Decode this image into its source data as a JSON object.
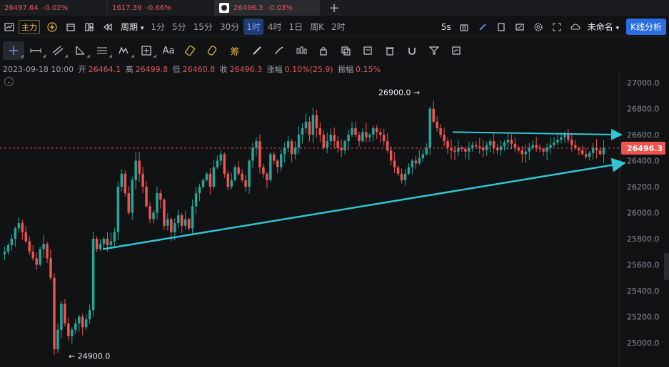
{
  "tabs": [
    {
      "price": "26497.64",
      "change": "-0.02%"
    },
    {
      "price": "1617.39",
      "change": "-0.66%"
    },
    {
      "price": "26496.3",
      "change": "-0.03%"
    }
  ],
  "toolbar": {
    "main_label": "主力",
    "period_label": "周期",
    "intervals": [
      "1分",
      "5分",
      "15分",
      "30分",
      "1时",
      "4时",
      "1日",
      "周K",
      "2时"
    ],
    "active_interval": "1时",
    "refresh": "5s",
    "layout_name": "未命名",
    "kline_analysis": "K线分析"
  },
  "draw_tools": {
    "text_tool": "Aa",
    "fund_tool": "筹"
  },
  "ohlc": {
    "datetime": "2023-09-18 10:00",
    "open_label": "开",
    "open": "26464.1",
    "high_label": "高",
    "high": "26499.8",
    "low_label": "低",
    "low": "26460.8",
    "close_label": "收",
    "close": "26496.3",
    "change_label": "涨幅",
    "change": "0.10%(25.9)",
    "amp_label": "振幅",
    "amp": "0.15%"
  },
  "chart_data": {
    "type": "candlestick",
    "y_ticks": [
      "27000.0",
      "26800.0",
      "26600.0",
      "26400.0",
      "26200.0",
      "26000.0",
      "25800.0",
      "25600.0",
      "25400.0",
      "25200.0",
      "25000.0"
    ],
    "ylim": [
      24900,
      27100
    ],
    "last_price": "26496.3",
    "high_marker": {
      "label": "26900.0",
      "value": 26900
    },
    "low_marker": {
      "label": "24900.0",
      "value": 24900
    },
    "up_color": "#26a69a",
    "down_color": "#ef5350",
    "trendline_color": "#2ec7d3",
    "closes": [
      25700,
      25750,
      25800,
      25880,
      25920,
      25850,
      25780,
      25700,
      25650,
      25600,
      25720,
      25760,
      25650,
      25500,
      24950,
      25100,
      25300,
      25150,
      25050,
      25100,
      25150,
      25200,
      25120,
      25180,
      25250,
      25800,
      25720,
      25760,
      25800,
      25750,
      25780,
      25850,
      26200,
      26300,
      26150,
      26000,
      26250,
      26400,
      26300,
      26200,
      26050,
      25950,
      26000,
      26150,
      26100,
      25900,
      25950,
      25850,
      25920,
      25980,
      25900,
      25950,
      25880,
      26050,
      26150,
      26200,
      26250,
      26300,
      26200,
      26350,
      26400,
      26450,
      26300,
      26200,
      26250,
      26350,
      26300,
      26250,
      26200,
      26400,
      26500,
      26550,
      26350,
      26300,
      26250,
      26450,
      26400,
      26350,
      26450,
      26500,
      26550,
      26450,
      26500,
      26600,
      26650,
      26700,
      26600,
      26750,
      26650,
      26600,
      26500,
      26550,
      26600,
      26550,
      26500,
      26480,
      26550,
      26600,
      26650,
      26600,
      26550,
      26620,
      26580,
      26600,
      26650,
      26620,
      26600,
      26550,
      26480,
      26400,
      26350,
      26300,
      26250,
      26300,
      26350,
      26400,
      26380,
      26420,
      26450,
      26500,
      26800,
      26700,
      26650,
      26600,
      26550,
      26500,
      26480,
      26470,
      26500,
      26490,
      26470,
      26500,
      26520,
      26510,
      26500,
      26480,
      26520,
      26550,
      26500,
      26480,
      26510,
      26540,
      26560,
      26530,
      26500,
      26480,
      26450,
      26470,
      26500,
      26520,
      26500,
      26490,
      26470,
      26500,
      26520,
      26540,
      26560,
      26580,
      26600,
      26560,
      26520,
      26500,
      26480,
      26450,
      26430,
      26460,
      26500,
      26480,
      26450,
      26496
    ]
  }
}
